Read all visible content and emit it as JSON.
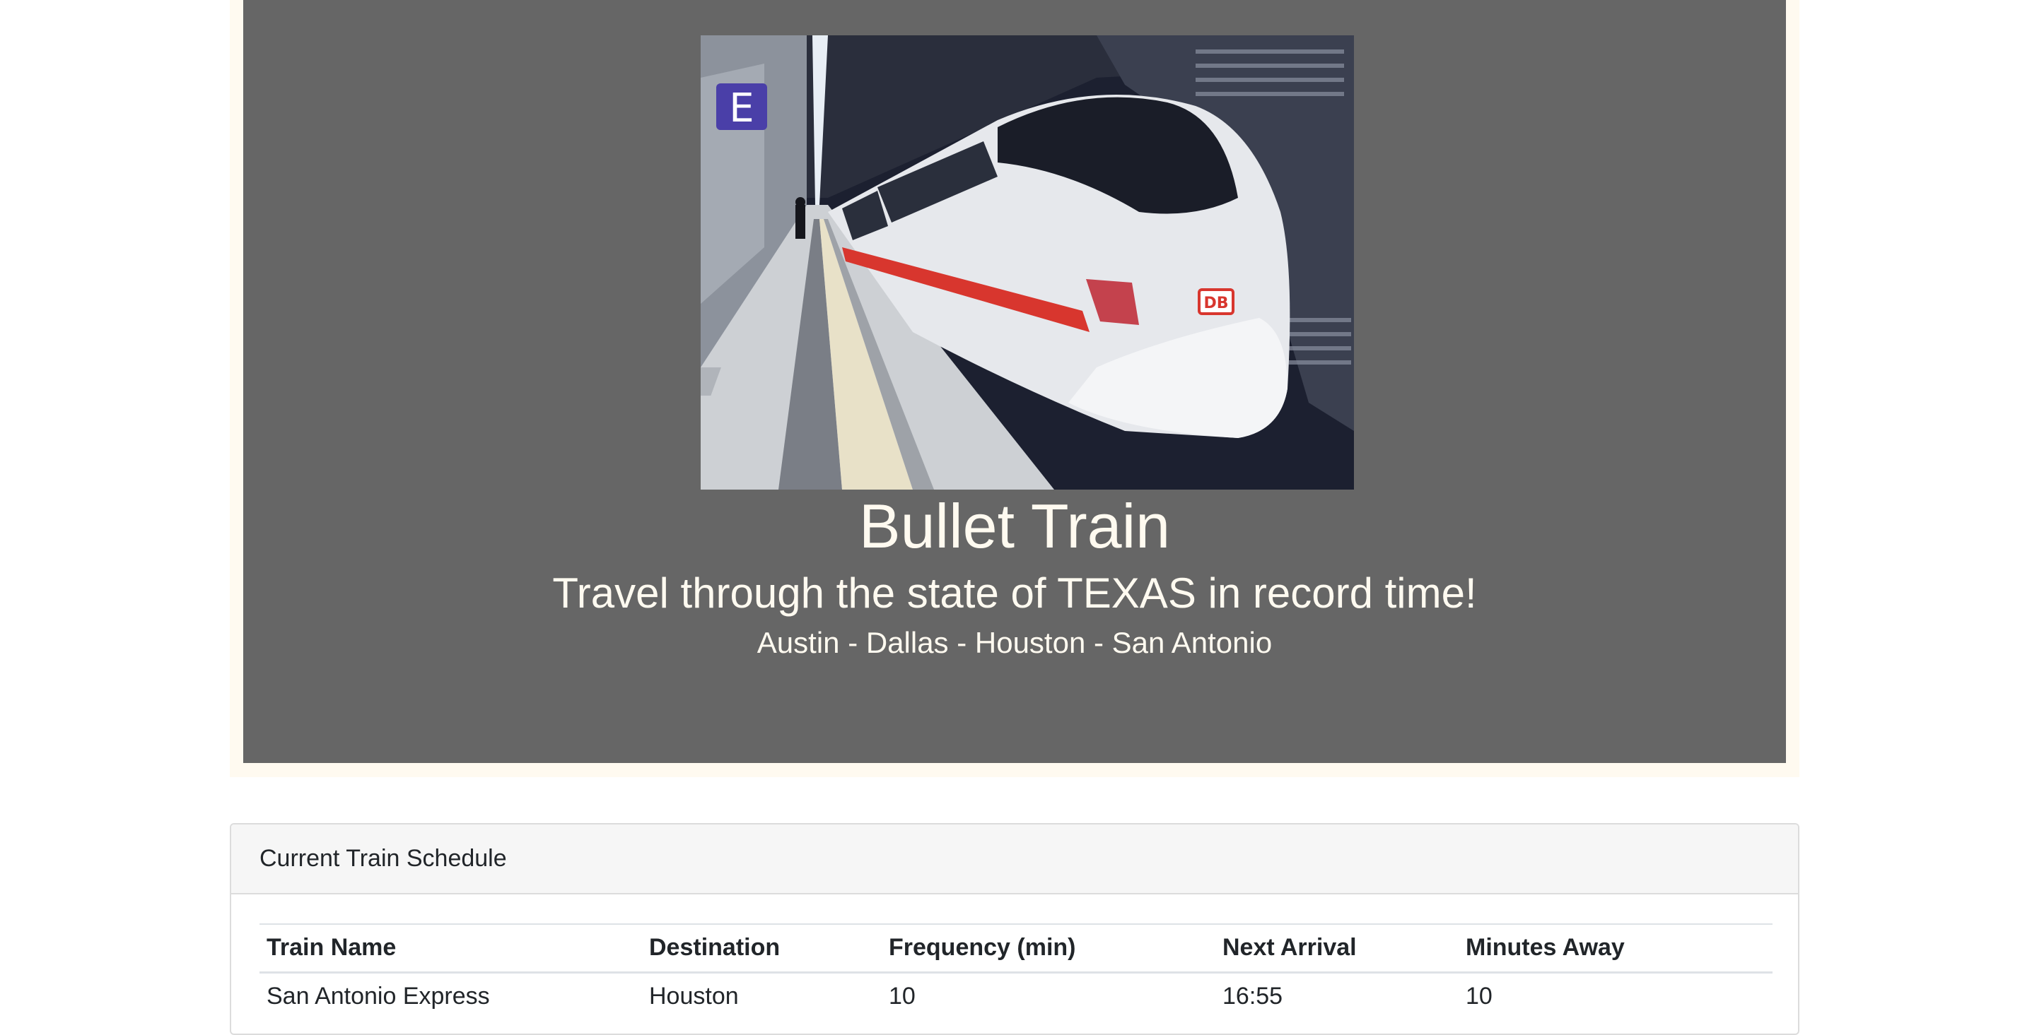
{
  "hero": {
    "title": "Bullet Train",
    "subtitle": "Travel through the state of TEXAS in record time!",
    "routes": "Austin - Dallas - Houston - San Antonio",
    "photo_sign_letter": "E",
    "photo_logo_text": "DB"
  },
  "schedule": {
    "header": "Current Train Schedule",
    "columns": [
      "Train Name",
      "Destination",
      "Frequency (min)",
      "Next Arrival",
      "Minutes Away"
    ],
    "rows": [
      [
        "San Antonio Express",
        "Houston",
        "10",
        "16:55",
        "10"
      ]
    ]
  },
  "colors": {
    "jumbotron_bg": "#666666",
    "jumbotron_text": "#fffaf0",
    "card_header_bg": "#f6f6f6"
  }
}
